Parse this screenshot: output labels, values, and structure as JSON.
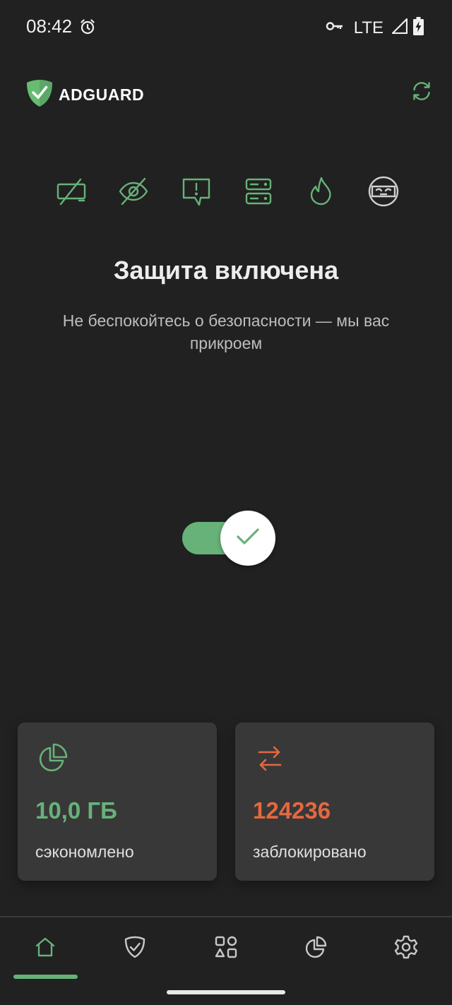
{
  "status_bar": {
    "time": "08:42",
    "network": "LTE",
    "icons": [
      "alarm-icon",
      "vpn-key-icon",
      "signal-icon",
      "battery-charging-icon"
    ]
  },
  "header": {
    "logo_text": "ADGUARD",
    "refresh_icon": "refresh-icon"
  },
  "feature_icons": [
    "no-ads-icon",
    "anti-tracking-icon",
    "annoyances-icon",
    "dns-server-icon",
    "firewall-icon",
    "stealth-mode-icon"
  ],
  "main": {
    "title": "Защита включена",
    "subtitle": "Не беспокойтесь о безопасности — мы вас прикроем",
    "protection_enabled": true
  },
  "stats": [
    {
      "icon": "pie-chart-icon",
      "value": "10,0 ГБ",
      "label": "сэкономлено",
      "color": "#67b279"
    },
    {
      "icon": "transfer-arrows-icon",
      "value": "124236",
      "label": "заблокировано",
      "color": "#e5683f"
    }
  ],
  "bottom_nav": {
    "items": [
      "home-icon",
      "protection-icon",
      "apps-icon",
      "statistics-icon",
      "settings-icon"
    ],
    "active": "home-icon"
  },
  "colors": {
    "background": "#212121",
    "accent_green": "#67b279",
    "accent_orange": "#e5683f",
    "card": "#383838"
  }
}
